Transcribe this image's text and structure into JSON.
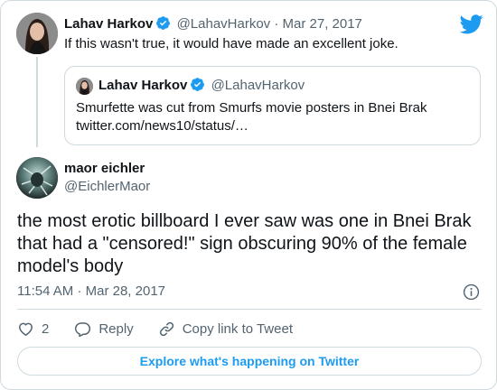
{
  "parent_tweet": {
    "author_name": "Lahav Harkov",
    "author_handle": "@LahavHarkov",
    "separator": "·",
    "date": "Mar 27, 2017",
    "text": "If this wasn't true, it would have made an excellent joke."
  },
  "quoted_tweet": {
    "author_name": "Lahav Harkov",
    "author_handle": "@LahavHarkov",
    "text_line1": "Smurfette was cut from Smurfs movie posters in Bnei Brak",
    "text_line2": "twitter.com/news10/status/…"
  },
  "main_tweet": {
    "author_name": "maor eichler",
    "author_handle": "@EichlerMaor",
    "text": "the most erotic billboard I ever saw was one in Bnei Brak that had a \"censored!\" sign obscuring 90% of the female model's body",
    "time": "11:54 AM",
    "separator": "·",
    "date": "Mar 28, 2017"
  },
  "actions": {
    "like_count": "2",
    "reply_label": "Reply",
    "copy_link_label": "Copy link to Tweet"
  },
  "explore_label": "Explore what's happening on Twitter",
  "icons": {
    "brand": "twitter-bird-icon",
    "verified": "verified-badge-icon",
    "info": "info-icon",
    "like": "heart-icon",
    "reply": "reply-bubble-icon",
    "copy_link": "link-icon"
  },
  "colors": {
    "brand_blue": "#1d9bf0",
    "text": "#0f1419",
    "secondary_text": "#536471",
    "border": "#cfd9de"
  }
}
